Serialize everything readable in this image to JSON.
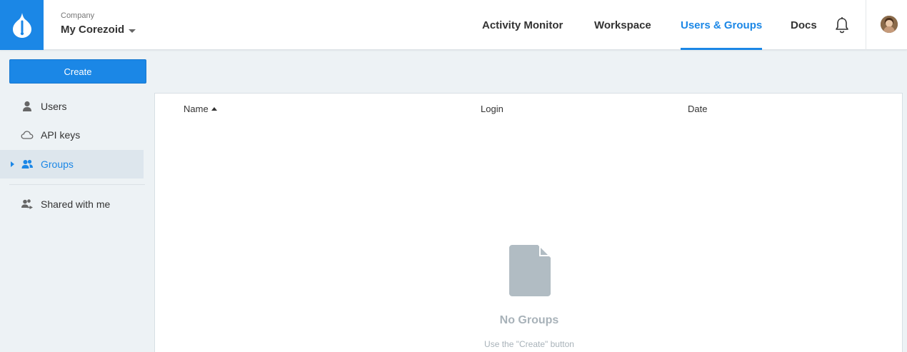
{
  "company": {
    "label": "Company",
    "name": "My Corezoid"
  },
  "nav": [
    {
      "label": "Activity Monitor"
    },
    {
      "label": "Workspace"
    },
    {
      "label": "Users & Groups",
      "active": true
    },
    {
      "label": "Docs"
    }
  ],
  "sidebar": {
    "create_label": "Create",
    "items": [
      {
        "label": "Users",
        "icon": "user-icon"
      },
      {
        "label": "API keys",
        "icon": "cloud-icon"
      },
      {
        "label": "Groups",
        "icon": "group-icon",
        "active": true
      },
      {
        "label": "Shared with me",
        "icon": "shared-icon"
      }
    ]
  },
  "table": {
    "columns": [
      "Name",
      "Login",
      "Date"
    ],
    "sort": {
      "column": "Name",
      "direction": "ascending"
    }
  },
  "empty_state": {
    "title": "No Groups",
    "hint": "Use the \"Create\" button"
  },
  "colors": {
    "accent": "#1b87e6",
    "background": "#edf2f5",
    "muted": "#a8b2b9",
    "active_item_bg": "#dde6ed"
  }
}
